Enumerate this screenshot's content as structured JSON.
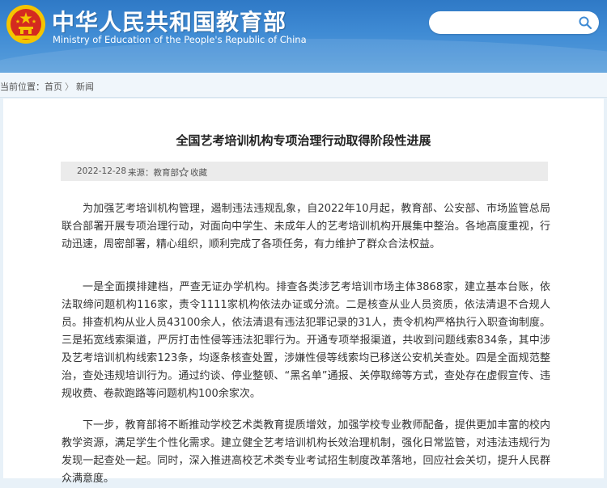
{
  "header": {
    "title_cn": "中华人民共和国教育部",
    "title_en": "Ministry of Education of the People's Republic of China",
    "search_placeholder": ""
  },
  "breadcrumb": {
    "label": "当前位置：",
    "items": [
      "首页",
      "新闻"
    ]
  },
  "article": {
    "title": "全国艺考培训机构专项治理行动取得阶段性进展",
    "date": "2022-12-28",
    "source": "来源：教育部",
    "favorite": "收藏",
    "paragraphs": [
      "为加强艺考培训机构管理，遏制违法违规乱象，自2022年10月起，教育部、公安部、市场监管总局联合部署开展专项治理行动，对面向中学生、未成年人的艺考培训机构开展集中整治。各地高度重视，行动迅速，周密部署，精心组织，顺利完成了各项任务，有力维护了群众合法权益。",
      "一是全面摸排建档，严查无证办学机构。排查各类涉艺考培训市场主体3868家，建立基本台账，依法取缔问题机构116家，责令1111家机构依法办证或分流。二是核查从业人员资质，依法清退不合规人员。排查机构从业人员43100余人，依法清退有违法犯罪记录的31人，责令机构严格执行入职查询制度。三是拓宽线索渠道，严厉打击性侵等违法犯罪行为。开通专项举报渠道，共收到问题线索834条，其中涉及艺考培训机构线索123条，均逐条核查处置，涉嫌性侵等线索均已移送公安机关查处。四是全面规范整治，查处违规培训行为。通过约谈、停业整顿、“黑名单”通报、关停取缔等方式，查处存在虚假宣传、违规收费、卷款跑路等问题机构100余家次。",
      "下一步，教育部将不断推动学校艺术类教育提质增效，加强学校专业教师配备，提供更加丰富的校内教学资源，满足学生个性化需求。建立健全艺考培训机构长效治理机制，强化日常监管，对违法违规行为发现一起查处一起。同时，深入推进高校艺术类专业考试招生制度改革落地，回应社会关切，提升人民群众满意度。"
    ]
  },
  "colors": {
    "header_blue": "#3f8bd4",
    "page_bg": "#e8f1f8",
    "emblem_red": "#d42a20",
    "emblem_gold": "#f5c400"
  }
}
